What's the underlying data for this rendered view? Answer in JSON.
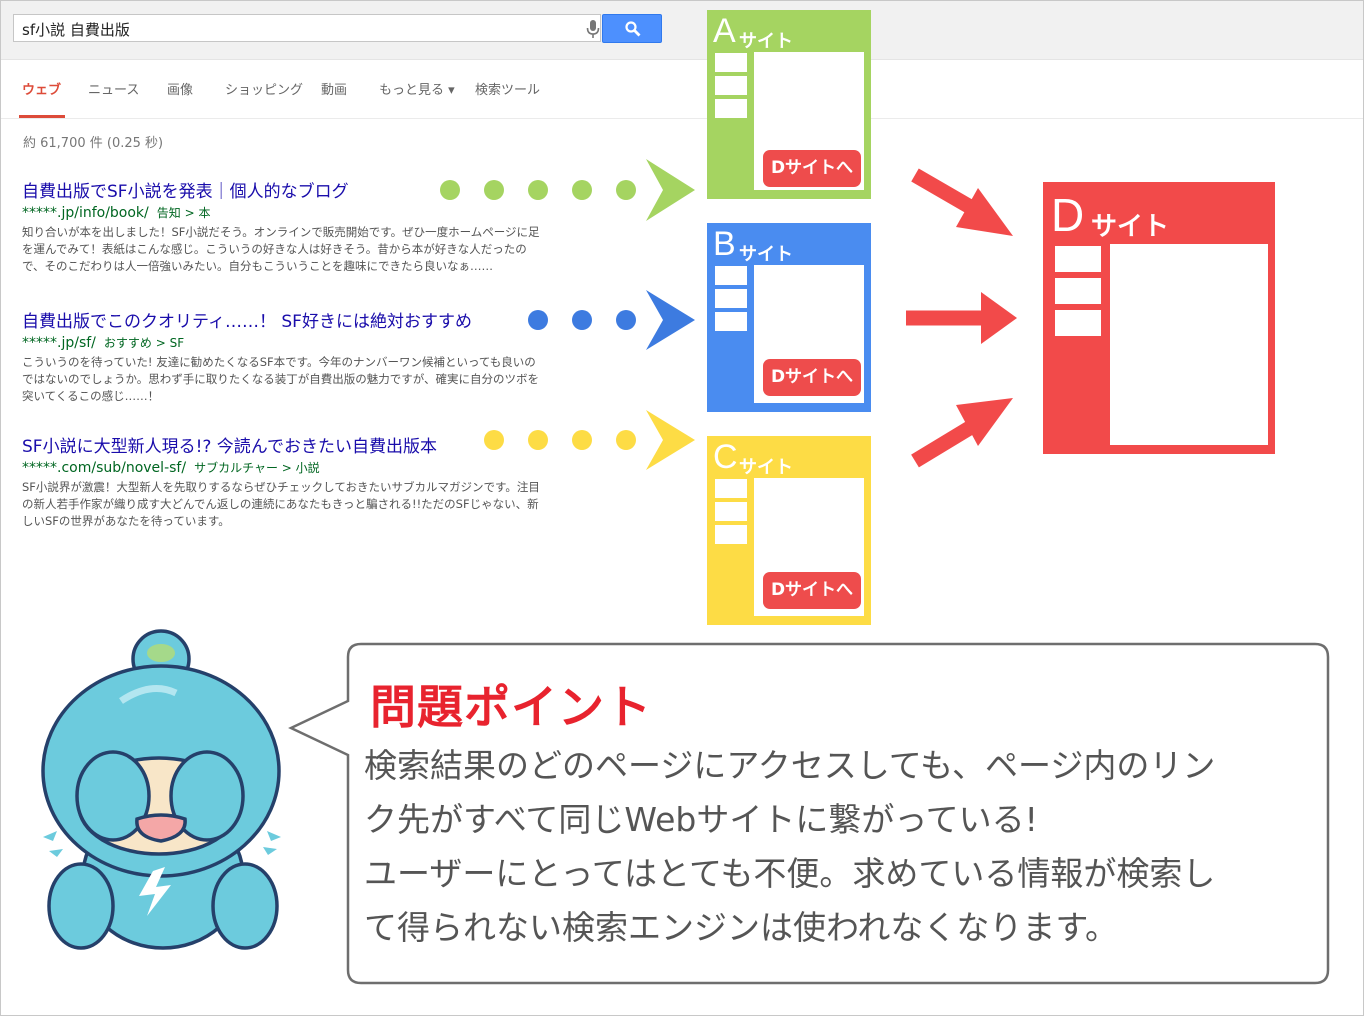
{
  "search": {
    "query": "sf小説 自費出版"
  },
  "tabs": [
    {
      "label": "ウェブ"
    },
    {
      "label": "ニュース"
    },
    {
      "label": "画像"
    },
    {
      "label": "ショッピング"
    },
    {
      "label": "動画"
    },
    {
      "label": "もっと見る ▾"
    },
    {
      "label": "検索ツール"
    }
  ],
  "stats": "約 61,700 件 (0.25 秒)",
  "results": [
    {
      "title": "自費出版でSF小説を発表｜個人的なブログ",
      "url": "*****.jp/info/book/",
      "crumb": "告知 > 本",
      "desc": "知り合いが本を出しました！SF小説だそう。オンラインで販売開始です。ぜひ一度ホームページに足を運んでみて！表紙はこんな感じ。こういうの好きな人は好きそう。昔から本が好きな人だったので、そのこだわりは人一倍強いみたい。自分もこういうことを趣味にできたら良いなぁ……"
    },
    {
      "title": "自費出版でこのクオリティ……！ SF好きには絶対おすすめ",
      "url": "*****.jp/sf/",
      "crumb": "おすすめ > SF",
      "desc": "こういうのを待っていた! 友達に勧めたくなるSF本です。今年のナンバーワン候補といっても良いのではないのでしょうか。思わず手に取りたくなる装丁が自費出版の魅力ですが、確実に自分のツボを突いてくるこの感じ……！"
    },
    {
      "title": "SF小説に大型新人現る!? 今読んでおきたい自費出版本",
      "url": "*****.com/sub/novel-sf/",
      "crumb": "サブカルチャー > 小説",
      "desc": "SF小説界が激震！大型新人を先取りするならぜひチェックしておきたいサブカルマガジンです。注目の新人若手作家が織り成す大どんでん返しの連続にあなたもきっと騙される!!ただのSFじゃない、新しいSFの世界があなたを待っています。"
    }
  ],
  "sites": [
    {
      "letter": "A",
      "label": "サイト",
      "color": "#a5d461",
      "button": "Dサイトへ"
    },
    {
      "letter": "B",
      "label": "サイト",
      "color": "#4a8cf0",
      "button": "Dサイトへ"
    },
    {
      "letter": "C",
      "label": "サイト",
      "color": "#fddc45",
      "button": "Dサイトへ"
    }
  ],
  "site_d": {
    "letter": "D",
    "label": "サイト",
    "color": "#f24a4a"
  },
  "colors": {
    "arrow": "#f24a4a",
    "dots_a": "#a5d461",
    "dots_b": "#3d7be0",
    "dots_c": "#fddc45",
    "mascot": "#6ccbdd"
  },
  "bubble": {
    "title": "問題ポイント",
    "lines": [
      "検索結果のどのページにアクセスしても、ページ内のリン",
      "ク先がすべて同じWebサイトに繋がっている!",
      "ユーザーにとってはとても不便。求めている情報が検索し",
      "て得られない検索エンジンは使われなくなります。"
    ]
  }
}
